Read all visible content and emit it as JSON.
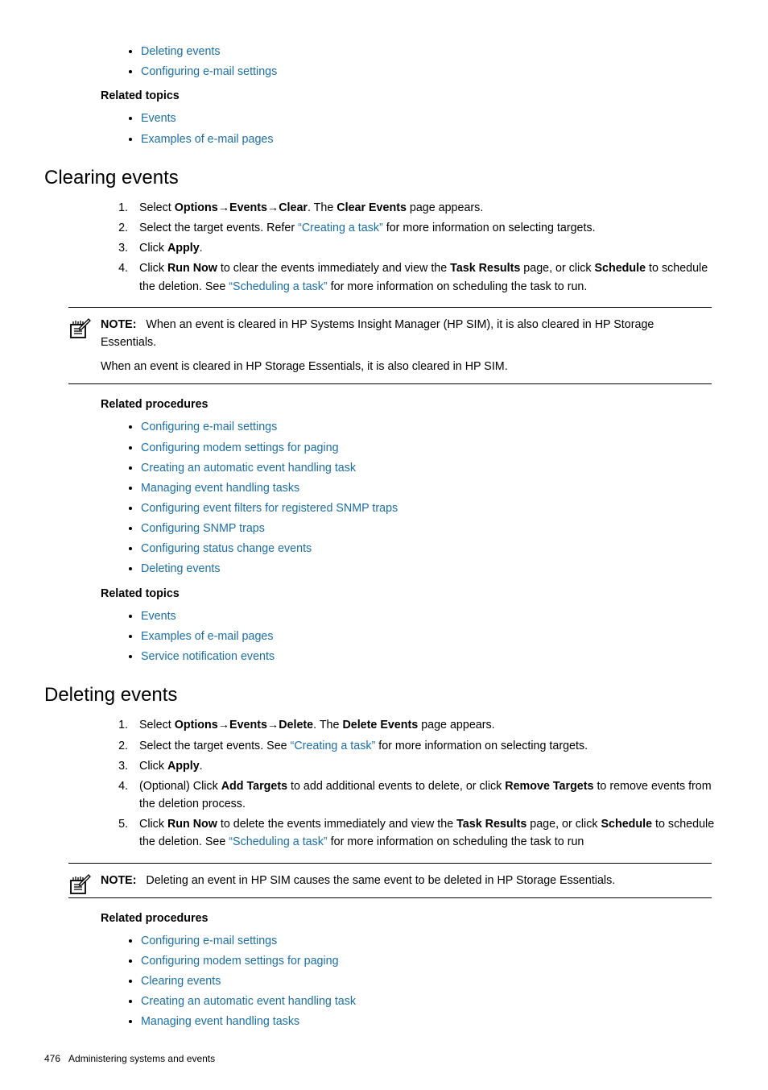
{
  "top": {
    "links1": [
      "Deleting events",
      "Configuring e-mail settings"
    ],
    "related_topics_label": "Related topics",
    "links2": [
      "Events",
      "Examples of e-mail pages"
    ]
  },
  "clearing": {
    "heading": "Clearing events",
    "step1_a": "Select ",
    "step1_b": "Options",
    "step1_c": "Events",
    "step1_d": "Clear",
    "step1_e": ". The ",
    "step1_f": "Clear Events",
    "step1_g": " page appears.",
    "step2_a": "Select the target events. Refer ",
    "step2_b": "“Creating a task”",
    "step2_c": " for more information on selecting targets.",
    "step3_a": "Click ",
    "step3_b": "Apply",
    "step3_c": ".",
    "step4_a": "Click ",
    "step4_b": "Run Now",
    "step4_c": " to clear the events immediately and view the ",
    "step4_d": "Task Results",
    "step4_e": " page, or click ",
    "step4_f": "Schedule",
    "step4_g": " to schedule the deletion. See ",
    "step4_h": "“Scheduling a task”",
    "step4_i": " for more information on scheduling the task to run.",
    "note_label": "NOTE:",
    "note1a": "When an event is cleared in HP Systems Insight Manager (HP SIM), it is also cleared in HP Storage Essentials.",
    "note1b": "When an event is cleared in HP Storage Essentials, it is also cleared in HP SIM.",
    "related_proc_label": "Related procedures",
    "proc_links": [
      "Configuring e-mail settings",
      "Configuring modem settings for paging",
      "Creating an automatic event handling task",
      "Managing event handling tasks",
      "Configuring event filters for registered SNMP traps",
      "Configuring SNMP traps",
      "Configuring status change events",
      "Deleting events"
    ],
    "related_topics_label": "Related topics",
    "topic_links": [
      "Events",
      "Examples of e-mail pages",
      "Service notification events"
    ]
  },
  "deleting": {
    "heading": "Deleting events",
    "step1_a": "Select ",
    "step1_b": "Options",
    "step1_c": "Events",
    "step1_d": "Delete",
    "step1_e": ". The ",
    "step1_f": "Delete Events",
    "step1_g": " page appears.",
    "step2_a": "Select the target events. See ",
    "step2_b": "“Creating a task”",
    "step2_c": " for more information on selecting targets.",
    "step3_a": "Click ",
    "step3_b": "Apply",
    "step3_c": ".",
    "step4_a": "(Optional) Click ",
    "step4_b": "Add Targets",
    "step4_c": " to add additional events to delete, or click ",
    "step4_d": "Remove Targets",
    "step4_e": " to remove events from the deletion process.",
    "step5_a": "Click ",
    "step5_b": "Run Now",
    "step5_c": " to delete the events immediately and view the ",
    "step5_d": "Task Results",
    "step5_e": " page, or click ",
    "step5_f": "Schedule",
    "step5_g": " to schedule the deletion. See ",
    "step5_h": "“Scheduling a task”",
    "step5_i": " for more information on scheduling the task to run",
    "note_label": "NOTE:",
    "note1": "Deleting an event in HP SIM causes the same event to be deleted in HP Storage Essentials.",
    "related_proc_label": "Related procedures",
    "proc_links": [
      "Configuring e-mail settings",
      "Configuring modem settings for paging",
      "Clearing events",
      "Creating an automatic event handling task",
      "Managing event handling tasks"
    ]
  },
  "footer": {
    "page": "476",
    "title": "Administering systems and events"
  },
  "arrow": "→"
}
